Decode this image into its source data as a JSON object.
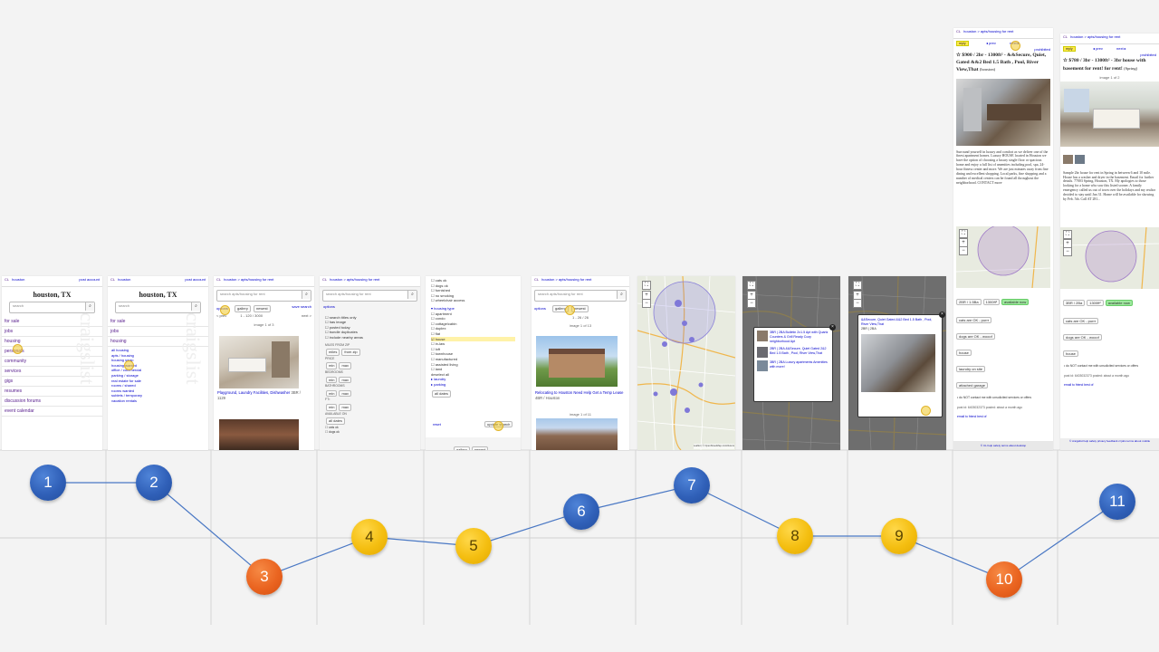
{
  "steps": [
    {
      "id": "1",
      "color": "#2f5fb3"
    },
    {
      "id": "2",
      "color": "#2f5fb3"
    },
    {
      "id": "3",
      "color": "#e8671f"
    },
    {
      "id": "4",
      "color": "#f2bb14"
    },
    {
      "id": "5",
      "color": "#f2bb14"
    },
    {
      "id": "6",
      "color": "#2f5fb3"
    },
    {
      "id": "7",
      "color": "#2f5fb3"
    },
    {
      "id": "8",
      "color": "#f2bb14"
    },
    {
      "id": "9",
      "color": "#f2bb14"
    },
    {
      "id": "10",
      "color": "#e8671f"
    },
    {
      "id": "11",
      "color": "#2f5fb3"
    }
  ],
  "s1": {
    "logo": "CL",
    "crumb": "houston",
    "post": "post  account",
    "city": "houston, TX",
    "search": "search",
    "items": [
      "for sale",
      "jobs",
      "housing",
      "personals",
      "community",
      "services",
      "gigs",
      "resumes",
      "discussion forums",
      "event calendar"
    ]
  },
  "s2": {
    "logo": "CL",
    "crumb": "houston",
    "post": "post  account",
    "city": "houston, TX",
    "search": "search",
    "items": [
      "for sale",
      "jobs",
      "housing"
    ],
    "subitems": [
      "all housing",
      "apts / housing",
      "housing swap",
      "housing wanted",
      "office / commercial",
      "parking / storage",
      "real estate for sale",
      "rooms / shared",
      "rooms wanted",
      "sublets / temporary",
      "vacation rentals"
    ]
  },
  "s3": {
    "logo": "CL",
    "crumb": "houston > apts/housing for rent",
    "search": "search apts/housing for rent",
    "options": "options",
    "gallery": "gallery",
    "newest": "newest",
    "savesearch": "save search",
    "pager": "1 - 120 / 3000",
    "prev": "< prev",
    "next": "next >",
    "imgcount": "image 1 of 3",
    "listing": "Playground, Laundry Facilities, Dishwasher",
    "listing_meta": "3BR / 1129"
  },
  "s4": {
    "logo": "CL",
    "crumb": "houston > apts/housing for rent",
    "search": "search apts/housing for rent",
    "options": "options",
    "checks": [
      "search titles only",
      "has image",
      "posted today",
      "bundle duplicates",
      "include nearby areas"
    ],
    "fields": [
      "MILES FROM ZIP",
      "PRICE",
      "BEDROOMS",
      "BATHROOMS",
      "FT²",
      "AVAILABLE ON"
    ],
    "miles": "miles",
    "fromzip": "from zip",
    "min": "min",
    "max": "max",
    "alldates": "all dates",
    "pets": [
      "cats ok",
      "dogs ok"
    ]
  },
  "s5": {
    "checks": [
      "cats ok",
      "dogs ok",
      "furnished",
      "no smoking",
      "wheelchair access"
    ],
    "housing_type": "housing type",
    "types": [
      "apartment",
      "condo",
      "cottage/cabin",
      "duplex",
      "flat",
      "house",
      "in-law",
      "loft",
      "townhouse",
      "manufactured",
      "assisted living",
      "land"
    ],
    "deselect": "deselect all",
    "laundry": "laundry",
    "parking": "parking",
    "alldates": "all dates",
    "reset": "reset",
    "update": "update search",
    "gallery": "gallery",
    "newest": "newest"
  },
  "s6": {
    "logo": "CL",
    "crumb": "houston > apts/housing for rent",
    "search": "search apts/housing for rent",
    "options": "options",
    "gallery": "gallery",
    "newest": "newest",
    "pager": "1 - 26 / 26",
    "imgcount1": "image 1 of 13",
    "listing": "Relocating to Houston Need Help Get a Temp Lease",
    "listing_meta": "4BR / Houston",
    "imgcount2": "image 1 of 11"
  },
  "s7": {
    "credit": "Leaflet | © OpenStreetMap contributors"
  },
  "s8": {
    "items": [
      "3BR | 2BA Bulletin 2x1.5 Apt with Quartz Counters & Grill Ready Cozy neighborhood Apt",
      "2BR | 2BA &&Secure, Quiet Gated 2&2 Bed 1.5 Bath , Pool, River View,That",
      "3BR | 2BA Luxury apartments Amenities with more!"
    ]
  },
  "s9": {
    "title": "&&Secure, Quiet Gated &&2 Bed 1.5 Bath , Pool, River View,That",
    "meta": "2BR | 2BA"
  },
  "s10": {
    "logo": "CL",
    "crumb": "houston > apts/housing for rent",
    "reply": "reply",
    "prev": "◂ prev",
    "next": "next ▸",
    "prohibited": "prohibited",
    "title": "$900 / 2br - 1300ft² - &&Secure, Quiet, Gated &&2 Bed 1.5 Bath , Pool, River View,That",
    "loc": "(houston)",
    "body": "Surround yourself in luxury and comfort as we deliver one of the finest apartment homes. Luxury HOUSE located in Houston we have the option of choosing a luxury single floor or spacious home and enjoy a full list of amenities including pool, spa, 24-hour fitness center and more. We are just minutes away from fine dining and excellent shopping. Local parks, fine shopping and a number of medical centers can be found all throughout the neighborhood. CONTACT more",
    "tags": [
      "2BR / 1.5Ba",
      "1300ft²",
      "available now"
    ],
    "attrs": [
      "cats are OK - purrr",
      "dogs are OK - wooof",
      "house",
      "laundry on site",
      "attached garage"
    ],
    "note": "do NOT contact me with unsolicited services or offers",
    "postid": "post id: 6403032373",
    "posted": "posted: about a month ago",
    "email": "email to friend",
    "flag": "best of"
  },
  "s11": {
    "logo": "CL",
    "crumb": "houston > apts/housing for rent",
    "reply": "reply",
    "prev": "◂ prev",
    "next": "next ▸",
    "prohibited": "prohibited",
    "title": "$780 / 3br - 1300ft² - 3br house with basement for rent! for rent!",
    "loc": "(Spring)",
    "imgcount": "image 1 of 2",
    "body": "Sample 2br house for rent in Spring in between 6 and 10 mile. House has a washer and dryer in the basement. Email for further details. 77003 Spring, Houston, TX. My apologies to those looking for a home who saw this listed sooner. A family emergency called us out of town over the holidays and my realtor decided to stay until Jan 31. Home will be available for showing by Feb. 5th. Call AT 281...",
    "tags": [
      "3BR / 2Ba",
      "1300ft²",
      "available now"
    ],
    "attrs": [
      "cats are OK - purrr",
      "dogs are OK - wooof",
      "house"
    ],
    "note": "do NOT contact me with unsolicited services or offers",
    "postid": "post id: 6403032373",
    "posted": "posted: about a month ago",
    "email": "email to friend",
    "flag": "best of",
    "footer": "© craigslist  help  safety  privacy  feedback  cl jobs  terms  about  mobile"
  }
}
